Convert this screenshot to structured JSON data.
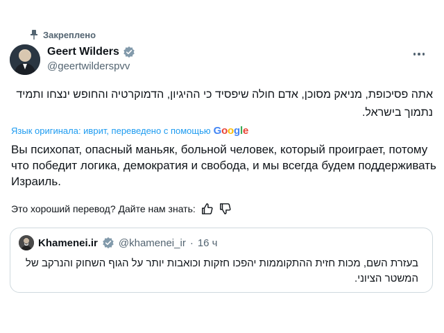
{
  "pinned": {
    "label": "Закреплено",
    "icon": "pin-icon"
  },
  "author": {
    "name": "Geert Wilders",
    "handle": "@geertwilderspvv",
    "verified_icon": "verified-badge-icon"
  },
  "post": {
    "original_text": "אתה פסיכופת, מניאק מסוכן, אדם חולה שיפסיד כי ההיגיון, הדמוקרטיה והחופש ינצחו ותמיד נתמוך בישראל.",
    "translation_note": "Язык оригинала: иврит, переведено с помощью",
    "translation_provider": "Google",
    "translated_text": "Вы психопат, опасный маньяк, больной человек, который проиграет, потому что победит логика, демократия и свобода, и мы всегда будем поддерживать Израиль.",
    "feedback_prompt": "Это хороший перевод? Дайте нам знать:"
  },
  "quoted": {
    "name": "Khamenei.ir",
    "handle": "@khamenei_ir",
    "separator": "·",
    "time": "16 ч",
    "text": "בעזרת השם, מכות חזית ההתקוממות יהפכו חזקות וכואבות יותר על הגוף השחוק והנרקב של המשטר הציוני."
  },
  "colors": {
    "text": "#0f1419",
    "secondary": "#536471",
    "link": "#1d9bf0",
    "verified": "#829aab",
    "border": "#cfd9de"
  }
}
